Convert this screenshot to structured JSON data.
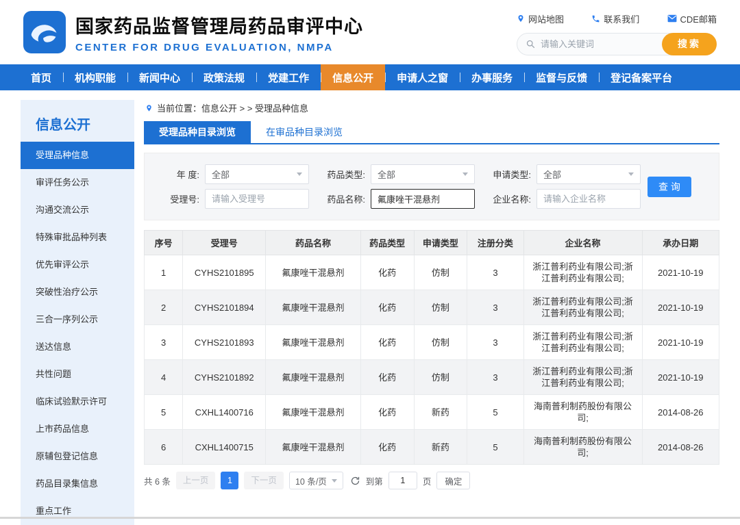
{
  "header": {
    "title": "国家药品监督管理局药品审评中心",
    "subtitle": "CENTER FOR DRUG EVALUATION, NMPA",
    "links": [
      {
        "icon": "location-pin-icon",
        "label": "网站地图"
      },
      {
        "icon": "phone-icon",
        "label": "联系我们"
      },
      {
        "icon": "mail-icon",
        "label": "CDE邮箱"
      }
    ],
    "search": {
      "placeholder": "请输入关键词",
      "button_label": "搜索"
    }
  },
  "nav": {
    "items": [
      {
        "label": "首页",
        "active": false
      },
      {
        "label": "机构职能",
        "active": false
      },
      {
        "label": "新闻中心",
        "active": false
      },
      {
        "label": "政策法规",
        "active": false
      },
      {
        "label": "党建工作",
        "active": false
      },
      {
        "label": "信息公开",
        "active": true
      },
      {
        "label": "申请人之窗",
        "active": false
      },
      {
        "label": "办事服务",
        "active": false
      },
      {
        "label": "监督与反馈",
        "active": false
      },
      {
        "label": "登记备案平台",
        "active": false
      }
    ]
  },
  "sidebar": {
    "title": "信息公开",
    "items": [
      {
        "label": "受理品种信息",
        "active": true
      },
      {
        "label": "审评任务公示",
        "active": false
      },
      {
        "label": "沟通交流公示",
        "active": false
      },
      {
        "label": "特殊审批品种列表",
        "active": false
      },
      {
        "label": "优先审评公示",
        "active": false
      },
      {
        "label": "突破性治疗公示",
        "active": false
      },
      {
        "label": "三合一序列公示",
        "active": false
      },
      {
        "label": "送达信息",
        "active": false
      },
      {
        "label": "共性问题",
        "active": false
      },
      {
        "label": "临床试验默示许可",
        "active": false
      },
      {
        "label": "上市药品信息",
        "active": false
      },
      {
        "label": "原辅包登记信息",
        "active": false
      },
      {
        "label": "药品目录集信息",
        "active": false
      },
      {
        "label": "重点工作",
        "active": false
      }
    ]
  },
  "main": {
    "breadcrumb": {
      "text": "当前位置：信息公开 > > 受理品种信息"
    },
    "tabs": [
      {
        "label": "受理品种目录浏览",
        "active": true
      },
      {
        "label": "在审品种目录浏览",
        "active": false
      }
    ],
    "filters": {
      "year_label": "年 度:",
      "year_value": "全部",
      "drug_type_label": "药品类型:",
      "drug_type_value": "全部",
      "apply_type_label": "申请类型:",
      "apply_type_value": "全部",
      "accept_no_label": "受理号:",
      "accept_no_placeholder": "请输入受理号",
      "drug_name_label": "药品名称:",
      "drug_name_value": "氟康唑干混悬剂",
      "company_label": "企业名称:",
      "company_placeholder": "请输入企业名称",
      "query_button": "查 询"
    },
    "table": {
      "headers": [
        "序号",
        "受理号",
        "药品名称",
        "药品类型",
        "申请类型",
        "注册分类",
        "企业名称",
        "承办日期"
      ],
      "rows": [
        [
          "1",
          "CYHS2101895",
          "氟康唑干混悬剂",
          "化药",
          "仿制",
          "3",
          "浙江普利药业有限公司;浙江普利药业有限公司;",
          "2021-10-19"
        ],
        [
          "2",
          "CYHS2101894",
          "氟康唑干混悬剂",
          "化药",
          "仿制",
          "3",
          "浙江普利药业有限公司;浙江普利药业有限公司;",
          "2021-10-19"
        ],
        [
          "3",
          "CYHS2101893",
          "氟康唑干混悬剂",
          "化药",
          "仿制",
          "3",
          "浙江普利药业有限公司;浙江普利药业有限公司;",
          "2021-10-19"
        ],
        [
          "4",
          "CYHS2101892",
          "氟康唑干混悬剂",
          "化药",
          "仿制",
          "3",
          "浙江普利药业有限公司;浙江普利药业有限公司;",
          "2021-10-19"
        ],
        [
          "5",
          "CXHL1400716",
          "氟康唑干混悬剂",
          "化药",
          "新药",
          "5",
          "海南普利制药股份有限公司;",
          "2014-08-26"
        ],
        [
          "6",
          "CXHL1400715",
          "氟康唑干混悬剂",
          "化药",
          "新药",
          "5",
          "海南普利制药股份有限公司;",
          "2014-08-26"
        ]
      ]
    },
    "pagination": {
      "total": "共 6 条",
      "prev": "上一页",
      "current_page": "1",
      "next": "下一页",
      "page_size": "10 条/页",
      "jump_label": "到第",
      "jump_value": "1",
      "jump_unit": "页",
      "confirm": "确定"
    }
  },
  "colors": {
    "primary_blue": "#1d70d2",
    "nav_active_orange": "#e8892b",
    "search_button_orange": "#f5a31d",
    "accent_blue": "#2e7ff0"
  }
}
